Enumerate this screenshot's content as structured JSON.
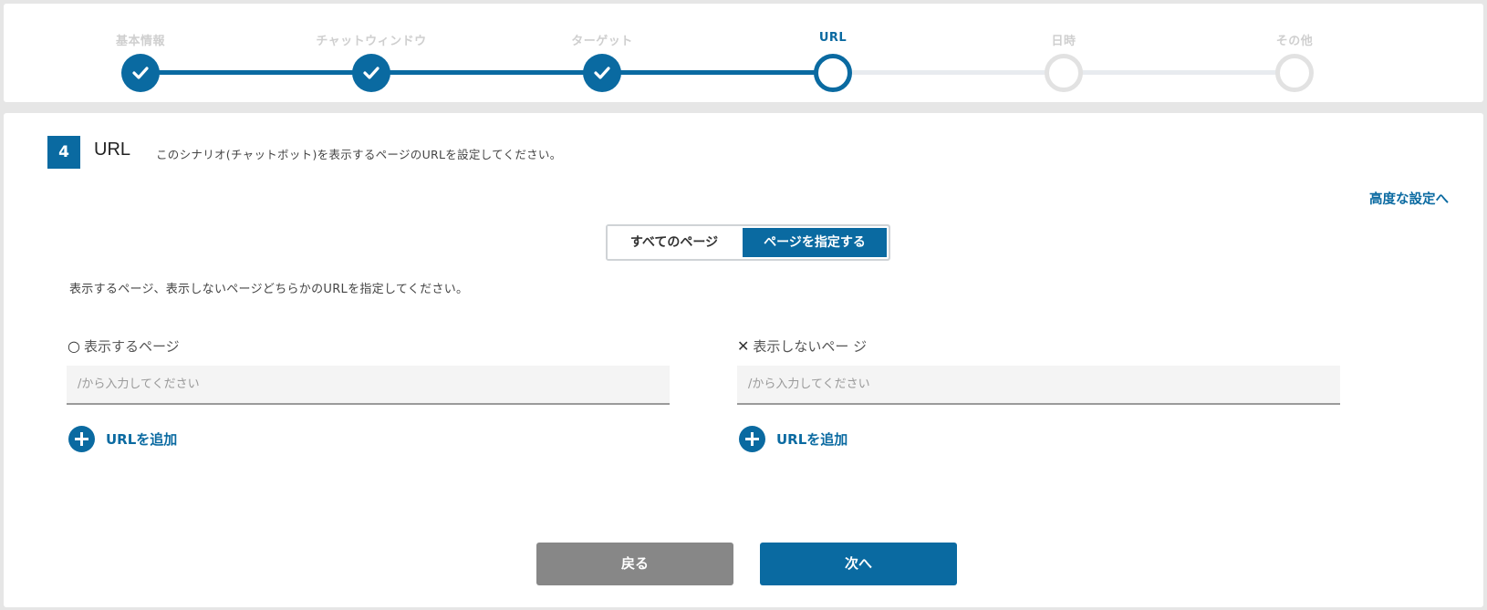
{
  "stepper": {
    "steps": [
      {
        "label": "基本情報",
        "state": "done"
      },
      {
        "label": "チャットウィンドウ",
        "state": "done"
      },
      {
        "label": "ターゲット",
        "state": "done"
      },
      {
        "label": "URL",
        "state": "current"
      },
      {
        "label": "日時",
        "state": "todo"
      },
      {
        "label": "その他",
        "state": "todo"
      }
    ],
    "check_icon": "check-icon"
  },
  "section": {
    "number": "4",
    "title": "URL",
    "description": "このシナリオ(チャットボット)を表示するページのURLを設定してください。"
  },
  "advanced_link": "高度な設定へ",
  "toggle": {
    "all_pages": "すべてのページ",
    "specify_pages": "ページを指定する",
    "selected": "specify_pages"
  },
  "instruction": "表示するページ、表示しないページどちらかのURLを指定してください。",
  "columns": {
    "show": {
      "glyph": "○",
      "label": "表示するページ",
      "placeholder": "/から入力してください",
      "add_label": "URLを追加"
    },
    "hide": {
      "glyph": "✕",
      "label": "表示しないペー ジ",
      "placeholder": "/から入力してください",
      "add_label": "URLを追加"
    }
  },
  "buttons": {
    "back": "戻る",
    "next": "次へ"
  },
  "colors": {
    "accent": "#0a6aa1",
    "inactive": "#e2e2e2",
    "back_button": "#878787"
  }
}
